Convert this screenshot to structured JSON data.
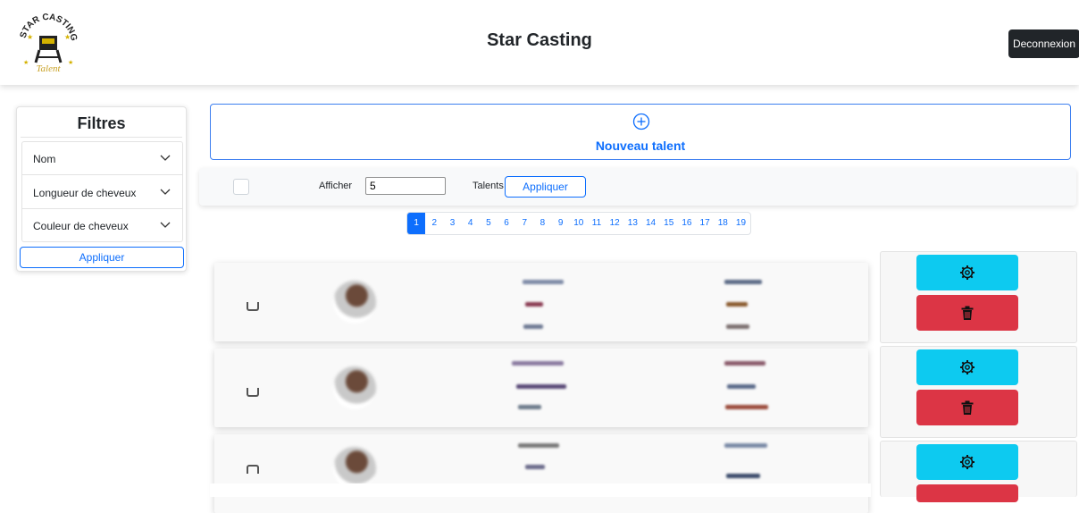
{
  "header": {
    "app_title": "Star Casting",
    "logout_label": "Deconnexion",
    "logo_text": "STAR CASTING",
    "logo_subtext": "Talent"
  },
  "filters": {
    "title": "Filtres",
    "items": [
      {
        "label": "Nom",
        "icon": "chevron-down-icon"
      },
      {
        "label": "Longueur de cheveux",
        "icon": "chevron-down-icon"
      },
      {
        "label": "Couleur de cheveux",
        "icon": "chevron-down-icon"
      }
    ],
    "apply_label": "Appliquer"
  },
  "new_talent": {
    "label": "Nouveau talent",
    "icon": "plus-circle-icon"
  },
  "toolbar": {
    "show_label": "Afficher",
    "show_value": "5",
    "talents_label": "Talents",
    "apply_label": "Appliquer"
  },
  "pagination": {
    "pages": [
      "1",
      "2",
      "3",
      "4",
      "5",
      "6",
      "7",
      "8",
      "9",
      "10",
      "11",
      "12",
      "13",
      "14",
      "15",
      "16",
      "17",
      "18",
      "19"
    ],
    "active": "1"
  },
  "talent_rows": {
    "actions": {
      "settings_icon": "gear-icon",
      "delete_icon": "trash-icon"
    }
  },
  "colors": {
    "primary": "#0d6efd",
    "settings_button": "#0dcaf0",
    "delete_button": "#dc3545",
    "logout_button": "#212529"
  }
}
